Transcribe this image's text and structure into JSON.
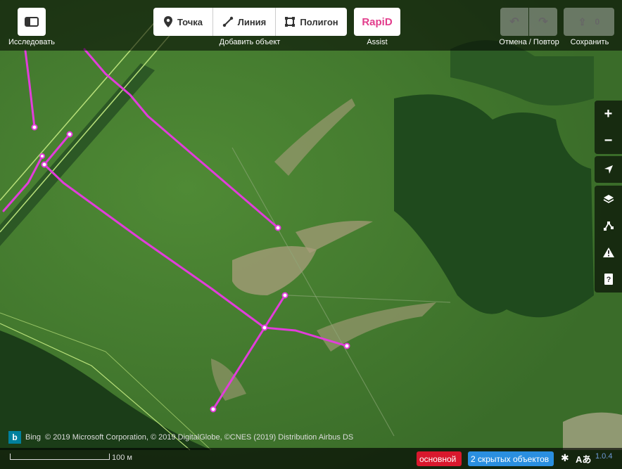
{
  "toolbar": {
    "explore_caption": "Исследовать",
    "add_caption": "Добавить объект",
    "point_label": "Точка",
    "line_label": "Линия",
    "polygon_label": "Полигон",
    "assist_logo": "RapiD",
    "assist_caption": "Assist",
    "undo_redo_caption": "Отмена / Повтор",
    "save_caption": "Сохранить",
    "save_count": "0"
  },
  "map_controls": [
    "zoom-in",
    "zoom-out",
    "geolocate",
    "background",
    "map-data",
    "issues",
    "help"
  ],
  "attribution": {
    "provider": "Bing",
    "text": "© 2019 Microsoft Corporation, © 2019 DigitalGlobe, ©CNES (2019) Distribution Airbus DS"
  },
  "footer": {
    "scale_label": "100 м",
    "main_badge": "основной",
    "hidden_badge": "2 скрытых объектов",
    "version": "1.0.4"
  },
  "colors": {
    "road": "#e23ddb",
    "main_badge": "#d9182d",
    "hidden_badge": "#2a8fe0"
  }
}
